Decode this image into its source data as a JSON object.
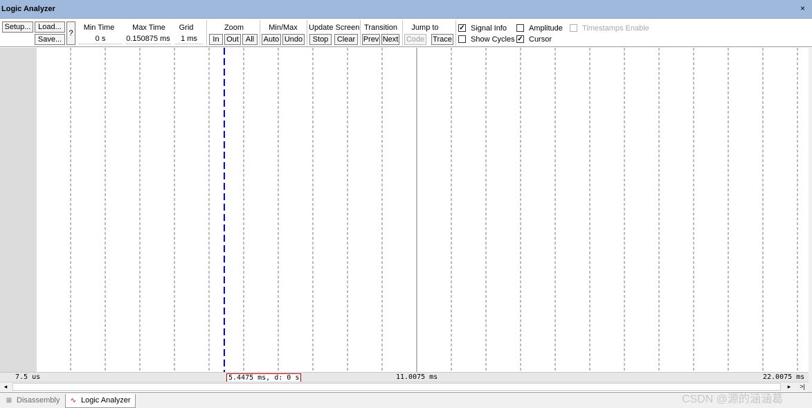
{
  "window": {
    "title": "Logic Analyzer",
    "close_glyph": "×"
  },
  "toolbar": {
    "setup": "Setup...",
    "load": "Load...",
    "save": "Save...",
    "help": "?",
    "min_time_label": "Min Time",
    "min_time_value": "0 s",
    "max_time_label": "Max Time",
    "max_time_value": "0.150875 ms",
    "grid_label": "Grid",
    "grid_value": "1 ms",
    "zoom_label": "Zoom",
    "zoom_in": "In",
    "zoom_out": "Out",
    "zoom_all": "All",
    "minmax_label": "Min/Max",
    "auto": "Auto",
    "undo": "Undo",
    "update_label": "Update Screen",
    "stop": "Stop",
    "clear": "Clear",
    "transition_label": "Transition",
    "prev": "Prev",
    "next": "Next",
    "jump_label": "Jump to",
    "code": "Code",
    "trace": "Trace",
    "signal_info": "Signal Info",
    "signal_info_checked": "✓",
    "show_cycles": "Show Cycles",
    "amplitude": "Amplitude",
    "cursor": "Cursor",
    "cursor_checked": "✓",
    "timestamps": "Timestamps Enable"
  },
  "timeline": {
    "left_time": "7.5 us",
    "cursor_readout": "5.4475 ms,  d: 0 s",
    "mid_time": "11.0075 ms",
    "right_time": "22.0075 ms",
    "cursor_color": "#0000ff",
    "grid_color": "#7a7a7a"
  },
  "scrollbar": {
    "left_glyph": "◂",
    "right_glyph": "▸",
    "end_glyph": ">|"
  },
  "tabs": [
    {
      "label": "Disassembly",
      "icon": "disassembly-icon",
      "glyph": "⊞"
    },
    {
      "label": "Logic Analyzer",
      "icon": "logic-analyzer-icon",
      "glyph": "∿"
    }
  ],
  "watermark": "CSDN @源的涵涵葛"
}
